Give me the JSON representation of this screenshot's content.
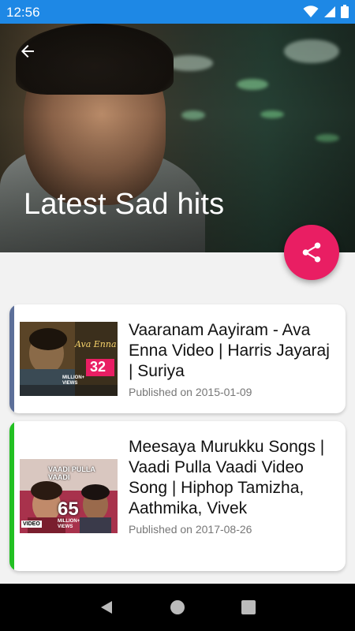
{
  "status_bar": {
    "time": "12:56"
  },
  "header": {
    "title": "Latest Sad hits"
  },
  "videos": [
    {
      "title": "Vaaranam Aayiram - Ava Enna Video | Harris Jayaraj | Suriya",
      "published": "Published on 2015-01-09",
      "accent_color": "#5c6f99",
      "thumbnail": {
        "caption": "Ava Enna",
        "count": "32",
        "unit": "MILLION+ VIEWS"
      }
    },
    {
      "title": "Meesaya Murukku Songs | Vaadi Pulla Vaadi Video Song | Hiphop Tamizha, Aathmika, Vivek",
      "published": "Published on 2017-08-26",
      "accent_color": "#22c022",
      "thumbnail": {
        "caption": "VAADI PULLA VAADI",
        "count": "65",
        "unit": "MILLION+ VIEWS",
        "tag": "VIDEO"
      }
    }
  ],
  "colors": {
    "status_bar": "#1e88e5",
    "fab": "#e91e63"
  },
  "icons": {
    "back": "arrow-left-icon",
    "share": "share-icon",
    "wifi": "wifi-icon",
    "signal": "signal-icon",
    "battery": "battery-icon"
  }
}
